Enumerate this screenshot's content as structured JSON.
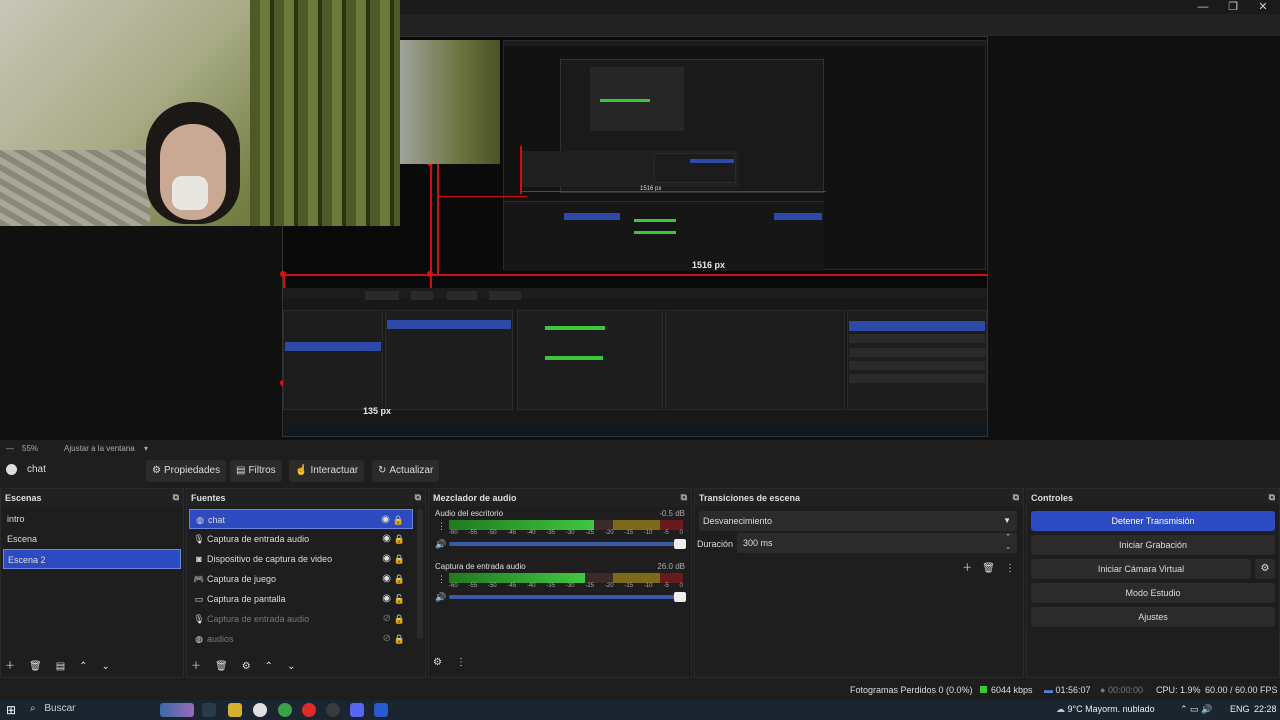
{
  "window": {
    "minimize": "—",
    "maximize": "❐",
    "close": "✕"
  },
  "preview": {
    "label_1516": "1516 px",
    "label_135": "135 px"
  },
  "zoom": {
    "collapse": "—",
    "level": "55%",
    "fit_label": "Ajustar a la ventana",
    "dropdown": "▾"
  },
  "toolbar": {
    "source": "chat",
    "properties": "Propiedades",
    "filters": "Filtros",
    "interact": "Interactuar",
    "refresh": "Actualizar"
  },
  "scenes": {
    "title": "Escenas",
    "items": [
      "intro",
      "Escena",
      "Escena 2"
    ],
    "selected": 2
  },
  "sources": {
    "title": "Fuentes",
    "items": [
      {
        "name": "chat",
        "icon": "globe-icon",
        "visible": true,
        "locked": true
      },
      {
        "name": "Captura de entrada audio",
        "icon": "mic-icon",
        "visible": true,
        "locked": true
      },
      {
        "name": "Dispositivo de captura de video",
        "icon": "camera-icon",
        "visible": true,
        "locked": true
      },
      {
        "name": "Captura de juego",
        "icon": "gamepad-icon",
        "visible": true,
        "locked": true
      },
      {
        "name": "Captura de pantalla",
        "icon": "monitor-icon",
        "visible": true,
        "locked": false
      },
      {
        "name": "Captura de entrada audio",
        "icon": "mic-icon",
        "visible": false,
        "locked": true
      },
      {
        "name": "audios",
        "icon": "globe-icon",
        "visible": false,
        "locked": true
      }
    ]
  },
  "mixer": {
    "title": "Mezclador de audio",
    "channels": [
      {
        "name": "Audio del escritorio",
        "db": "-0.5 dB",
        "level": 0.62
      },
      {
        "name": "Captura de entrada audio",
        "db": "26.0 dB",
        "level": 0.58
      }
    ],
    "ticks": [
      "-60",
      "-55",
      "-50",
      "-45",
      "-40",
      "-35",
      "-30",
      "-25",
      "-20",
      "-15",
      "-10",
      "-5",
      "0"
    ]
  },
  "transitions": {
    "title": "Transiciones de escena",
    "selected": "Desvanecimiento",
    "duration_label": "Duración",
    "duration_value": "300 ms"
  },
  "controls": {
    "title": "Controles",
    "stop_stream": "Detener Transmisión",
    "start_recording": "Iniciar Grabación",
    "virtual_cam": "Iniciar Cámara Virtual",
    "studio_mode": "Modo Estudio",
    "settings": "Ajustes"
  },
  "status": {
    "dropped": "Fotogramas Perdidos 0 (0.0%)",
    "bitrate": "6044 kbps",
    "stream_time": "01:56:07",
    "rec_time": "00:00:00",
    "cpu": "CPU: 1.9%",
    "fps": "60.00 / 60.00 FPS"
  },
  "taskbar": {
    "search": "Buscar",
    "weather": "9°C  Mayorm. nublado",
    "lang": "ENG",
    "time": "22:28"
  }
}
